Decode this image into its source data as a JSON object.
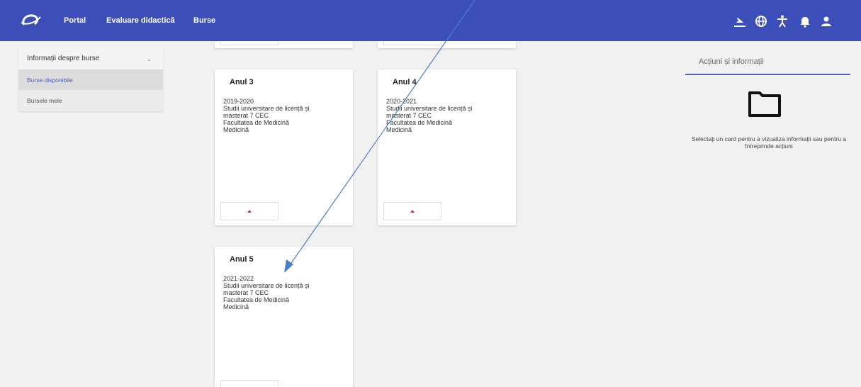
{
  "header": {
    "nav": [
      "Portal",
      "Evaluare didactică",
      "Burse"
    ],
    "icons": [
      "app-logo-icon",
      "theme-icon",
      "globe-icon",
      "accessibility-icon",
      "bell-icon",
      "user-icon"
    ],
    "color": "#3c4fb8"
  },
  "sidebar": {
    "title": "Informații despre burse",
    "items": [
      {
        "label": "Burse disponibile",
        "selected": true
      },
      {
        "label": "Bursele mele",
        "selected": false
      }
    ]
  },
  "cards": [
    {
      "title": "Anul 3",
      "lines": [
        "2019-2020",
        "Studii universitare de licență și",
        "masterat 7 CEC",
        "Facultatea de Medicină",
        "Medicină"
      ]
    },
    {
      "title": "Anul 4",
      "lines": [
        "2020-2021",
        "Studii universitare de licență și",
        "masterat 7 CEC",
        "Facultatea de Medicină",
        "Medicină"
      ]
    },
    {
      "title": "Anul 5",
      "lines": [
        "2021-2022",
        "Studii universitare de licență și",
        "masterat 7 CEC",
        "Facultatea de Medicină",
        "Medicină"
      ]
    }
  ],
  "right_panel": {
    "title": "Acțiuni și informații",
    "info": "Selectați un card pentru a vizualiza informații sau pentru a întreprinde acțiuni",
    "icon": "folder-icon"
  },
  "colors": {
    "accent": "#4a5fc1",
    "button_arrow": "#d9265a",
    "annotation_arrow": "#4a7fc8"
  }
}
